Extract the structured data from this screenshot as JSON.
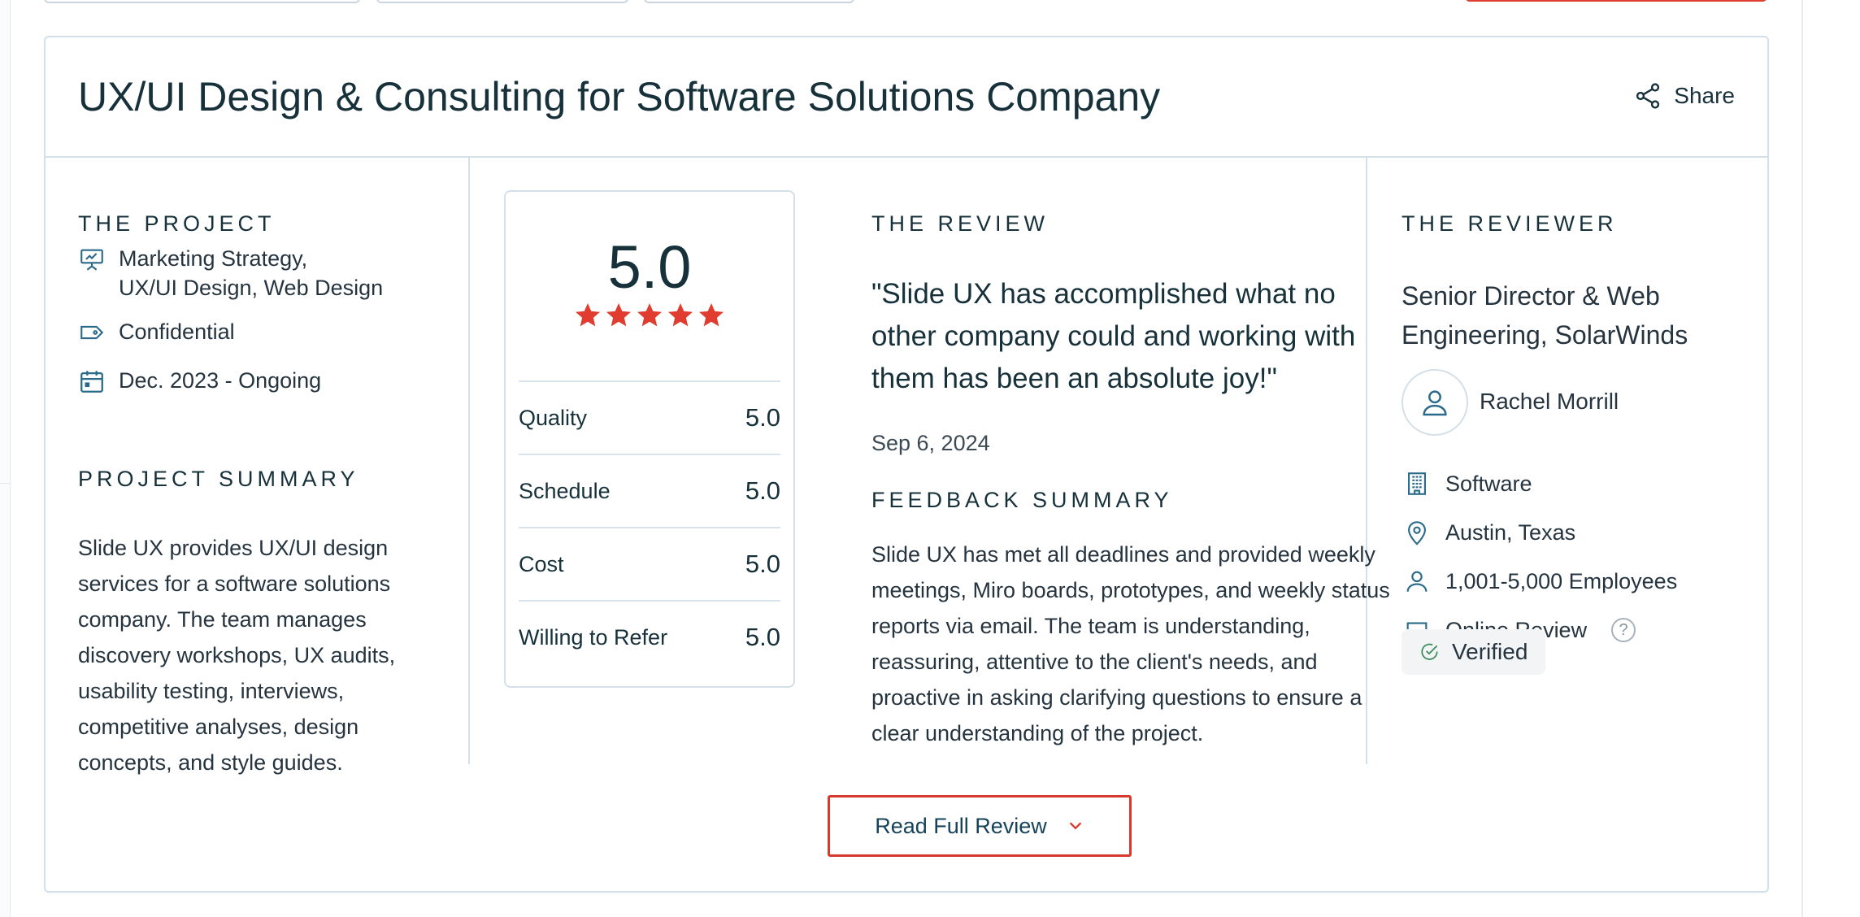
{
  "review": {
    "title": "UX/UI Design & Consulting for Software Solutions Company",
    "share_label": "Share",
    "project": {
      "heading": "THE PROJECT",
      "services_line1": "Marketing Strategy,",
      "services_line2": "UX/UI Design, Web Design",
      "budget": "Confidential",
      "dates": "Dec. 2023 - Ongoing",
      "summary_heading": "PROJECT SUMMARY",
      "summary": "Slide UX provides UX/UI design services for a software solutions company. The team manages discovery workshops, UX audits, usability testing, interviews, competitive analyses, design concepts, and style guides."
    },
    "ratings": {
      "overall": "5.0",
      "stars": 5,
      "star_color": "#e03c2f",
      "items": [
        {
          "label": "Quality",
          "value": "5.0"
        },
        {
          "label": "Schedule",
          "value": "5.0"
        },
        {
          "label": "Cost",
          "value": "5.0"
        },
        {
          "label": "Willing to Refer",
          "value": "5.0"
        }
      ]
    },
    "body": {
      "heading": "THE REVIEW",
      "quote": "\"Slide UX has accomplished what no other company could and working with them has been an absolute joy!\"",
      "date": "Sep 6, 2024",
      "feedback_heading": "FEEDBACK SUMMARY",
      "feedback": "Slide UX has met all deadlines and provided weekly meetings, Miro boards, prototypes, and weekly status reports via email. The team is understanding, reassuring, attentive to the client's needs, and proactive in asking clarifying questions to ensure a clear understanding of the project."
    },
    "reviewer": {
      "heading": "THE REVIEWER",
      "title": "Senior Director & Web Engineering, SolarWinds",
      "name": "Rachel Morrill",
      "industry": "Software",
      "location": "Austin, Texas",
      "size": "1,001-5,000 Employees",
      "review_type": "Online Review",
      "help": "?",
      "verified": "Verified"
    },
    "read_full_label": "Read Full Review",
    "accent_color": "#d73a2c"
  }
}
